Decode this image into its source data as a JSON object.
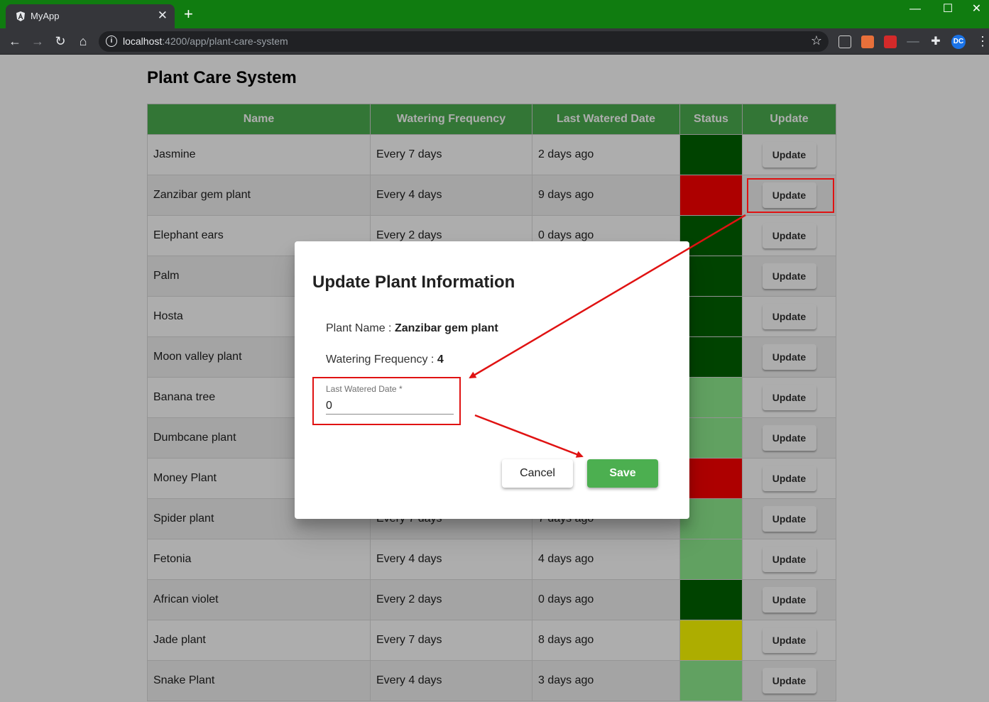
{
  "browser": {
    "tab_title": "MyApp",
    "new_tab_icon": "+",
    "url_host": "localhost",
    "url_path": ":4200/app/plant-care-system",
    "title_bar_color": "#107c10",
    "extensions": [
      {
        "name": "angular-devtools-icon",
        "color": "#d0d0d0"
      },
      {
        "name": "extension-orange-icon",
        "color": "#e8703a"
      },
      {
        "name": "extension-red-icon",
        "color": "#d42a2a"
      },
      {
        "name": "extension-gray-icon",
        "color": "#5f6368"
      },
      {
        "name": "puzzle-icon",
        "color": "#e8eaed"
      },
      {
        "name": "profile-avatar-icon",
        "color": "#1a73e8"
      }
    ]
  },
  "page": {
    "title": "Plant Care System"
  },
  "table": {
    "headers": [
      "Name",
      "Watering Frequency",
      "Last Watered Date",
      "Status",
      "Update"
    ],
    "update_label": "Update",
    "status_colors": {
      "watered": "#006400",
      "ok": "#90ee90",
      "due": "#ffff00",
      "overdue": "#ff0000"
    },
    "rows": [
      {
        "name": "Jasmine",
        "frequency": "Every 7 days",
        "last_watered": "2 days ago",
        "status": "watered"
      },
      {
        "name": "Zanzibar gem plant",
        "frequency": "Every 4 days",
        "last_watered": "9 days ago",
        "status": "overdue"
      },
      {
        "name": "Elephant ears",
        "frequency": "Every 2 days",
        "last_watered": "0 days ago",
        "status": "watered"
      },
      {
        "name": "Palm",
        "frequency": "",
        "last_watered": "",
        "status": "watered"
      },
      {
        "name": "Hosta",
        "frequency": "",
        "last_watered": "",
        "status": "watered"
      },
      {
        "name": "Moon valley plant",
        "frequency": "",
        "last_watered": "",
        "status": "watered"
      },
      {
        "name": "Banana tree",
        "frequency": "",
        "last_watered": "",
        "status": "ok"
      },
      {
        "name": "Dumbcane plant",
        "frequency": "",
        "last_watered": "",
        "status": "ok"
      },
      {
        "name": "Money Plant",
        "frequency": "",
        "last_watered": "",
        "status": "overdue"
      },
      {
        "name": "Spider plant",
        "frequency": "Every 7 days",
        "last_watered": "7 days ago",
        "status": "ok"
      },
      {
        "name": "Fetonia",
        "frequency": "Every 4 days",
        "last_watered": "4 days ago",
        "status": "ok"
      },
      {
        "name": "African violet",
        "frequency": "Every 2 days",
        "last_watered": "0 days ago",
        "status": "watered"
      },
      {
        "name": "Jade plant",
        "frequency": "Every 7 days",
        "last_watered": "8 days ago",
        "status": "due"
      },
      {
        "name": "Snake Plant",
        "frequency": "Every 4 days",
        "last_watered": "3 days ago",
        "status": "ok"
      }
    ]
  },
  "dialog": {
    "title": "Update Plant Information",
    "plant_name_label": "Plant Name : ",
    "plant_name_value": "Zanzibar gem plant",
    "frequency_label": "Watering Frequency : ",
    "frequency_value": "4",
    "field_label": "Last Watered Date *",
    "field_value": "0",
    "cancel_label": "Cancel",
    "save_label": "Save"
  },
  "annotation_color": "#e01212"
}
